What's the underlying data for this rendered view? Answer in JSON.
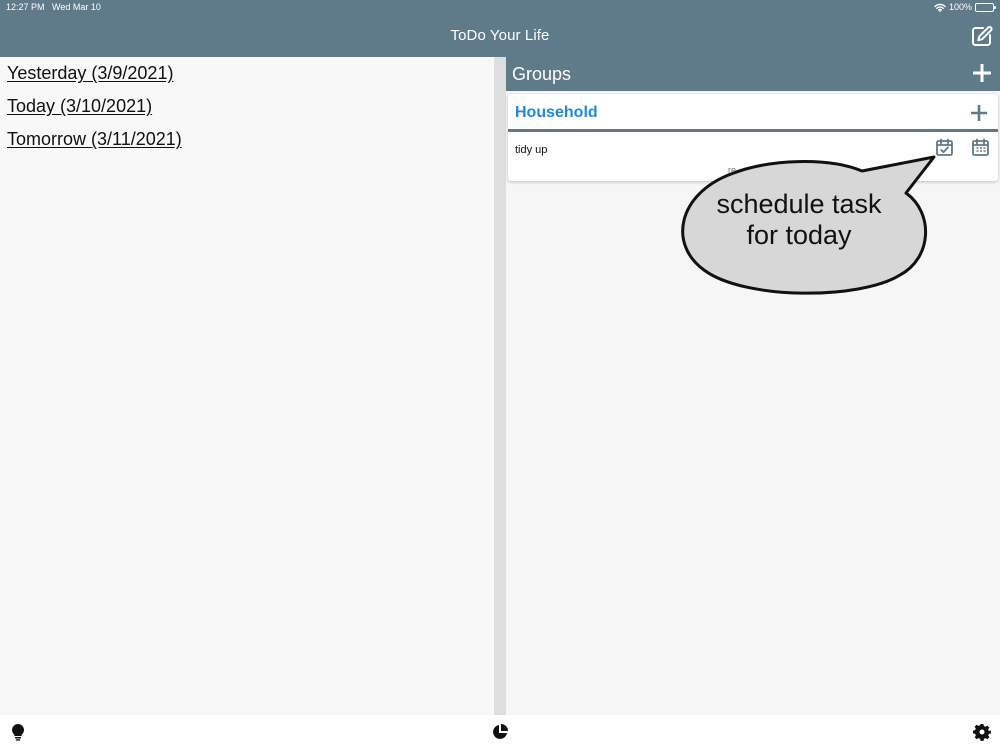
{
  "status_bar": {
    "time": "12:27 PM",
    "date": "Wed Mar 10",
    "battery": "100%",
    "battery_level": 1.0
  },
  "header": {
    "title": "ToDo Your Life",
    "compose_icon": "edit-icon"
  },
  "days": {
    "yesterday": "Yesterday (3/9/2021)",
    "today": "Today (3/10/2021)",
    "tomorrow": "Tomorrow (3/11/2021)"
  },
  "groups": {
    "title": "Groups",
    "add_icon": "plus-icon",
    "items": [
      {
        "name": "Household",
        "tasks": [
          {
            "label": "tidy up",
            "partial_text": "re",
            "today_icon": "calendar-check-icon",
            "schedule_icon": "calendar-icon"
          }
        ]
      }
    ]
  },
  "callout": {
    "line1": "schedule task",
    "line2": "for today"
  },
  "bottom_bar": {
    "left_icon": "lightbulb-icon",
    "center_icon": "pie-chart-icon",
    "right_icon": "gear-icon"
  },
  "colors": {
    "header": "#5f7a88",
    "link_blue": "#1e88e5",
    "callout_fill": "#d7d7d7"
  }
}
